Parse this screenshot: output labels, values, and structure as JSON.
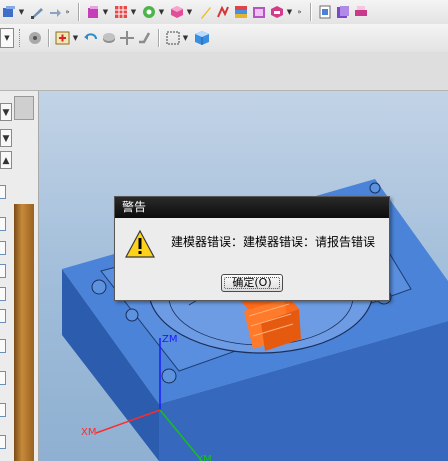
{
  "dialog": {
    "title": "警告",
    "message": "建模器错误：建模器错误：请报告错误",
    "ok_label": "确定(O)"
  },
  "viewport": {
    "axis_z": "ZM",
    "axis_x": "XM",
    "axis_y": "YM"
  },
  "colors": {
    "block_top": "#4d85da",
    "block_side": "#2e5fb6",
    "part_orange": "#ff6a1a",
    "dialog_title": "#111111"
  }
}
